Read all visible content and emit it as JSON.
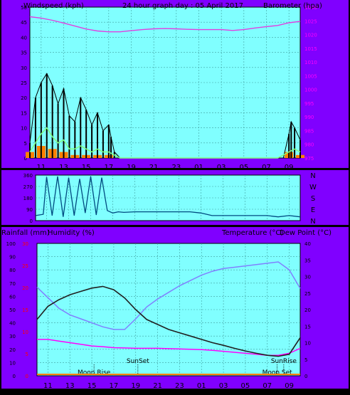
{
  "header": {
    "left_label": "Windspeed (kph)",
    "title": "24 hour graph day : 05 April 2017",
    "right_label": "Barometer (hpa)"
  },
  "labels": {
    "rainfall": "Rainfall (mm)",
    "humidity": "Humidity (%)",
    "temperature": "Temperature (°C)",
    "dew_point": "Dew Point (°C)"
  },
  "x_ticks": [
    "11",
    "13",
    "15",
    "17",
    "19",
    "21",
    "23",
    "01",
    "03",
    "05",
    "07",
    "09"
  ],
  "x_ticks_bottom": [
    "11",
    "13",
    "15",
    "17",
    "19",
    "21",
    "23",
    "01",
    "03",
    "05",
    "07",
    "09"
  ],
  "events": [
    {
      "label": "Moon Rise",
      "hour": "14.2"
    },
    {
      "label": "SunSet",
      "hour": "18.2"
    },
    {
      "label": "Moon Set",
      "hour": "30.9"
    },
    {
      "label": "SunRise",
      "hour": "31.5"
    }
  ],
  "colors": {
    "plot_bg": "#80ffff",
    "frame": "#8000ff",
    "wind_gust": "#000000",
    "wind_avg": "#80ff80",
    "rain": "#ff8000",
    "barometer": "#e040e0",
    "humidity": "#8080ff",
    "temperature": "#202020",
    "dewpoint": "#ff00ff",
    "direction": "#004a80"
  },
  "chart_data": [
    {
      "type": "line",
      "title": "24 hour graph day : 05 April 2017",
      "xlabel": "",
      "x_range_hours": [
        9,
        33
      ],
      "y_left": {
        "label": "Windspeed (kph)",
        "range": [
          0,
          50
        ],
        "ticks": [
          "0",
          "5",
          "10",
          "15",
          "20",
          "25",
          "30",
          "35",
          "40",
          "45",
          "50"
        ]
      },
      "y_right": {
        "label": "Barometer (hpa)",
        "range": [
          975,
          1030
        ],
        "ticks": [
          "975",
          "980",
          "985",
          "990",
          "995",
          "1000",
          "1005",
          "1010",
          "1015",
          "1020",
          "1025",
          "1030"
        ]
      },
      "series": [
        {
          "name": "Barometer (hpa)",
          "axis": "right",
          "x": [
            9,
            10,
            11,
            12,
            13,
            14,
            15,
            16,
            17,
            18,
            19,
            20,
            21,
            22,
            23,
            24,
            25,
            26,
            27,
            28,
            29,
            30,
            31,
            32,
            33
          ],
          "values": [
            1026.5,
            1026.0,
            1025.2,
            1024.2,
            1023.1,
            1022.0,
            1021.3,
            1021.0,
            1021.0,
            1021.4,
            1021.8,
            1022.1,
            1022.2,
            1022.1,
            1021.9,
            1021.8,
            1021.8,
            1021.8,
            1021.5,
            1021.8,
            1022.4,
            1022.9,
            1023.3,
            1024.3,
            1024.8
          ]
        },
        {
          "name": "Windspeed gust (kph)",
          "axis": "left",
          "x": [
            9,
            9.5,
            10,
            10.5,
            11,
            11.5,
            12,
            12.5,
            13,
            13.5,
            14,
            14.5,
            15,
            15.5,
            16,
            16.2,
            16.5,
            17,
            31,
            31.5,
            32,
            32.2,
            32.5,
            33
          ],
          "values": [
            5,
            20,
            25,
            28,
            24,
            18,
            23,
            14,
            12,
            20,
            16,
            11,
            15,
            9,
            11,
            7,
            2,
            0,
            0,
            0,
            8,
            12,
            10,
            6
          ]
        },
        {
          "name": "Windspeed avg (kph)",
          "axis": "left",
          "x": [
            9,
            9.5,
            10,
            10.5,
            11,
            11.5,
            12,
            12.5,
            13,
            13.5,
            14,
            14.5,
            15,
            15.5,
            16,
            16.5,
            17,
            31,
            32,
            32.5,
            33
          ],
          "values": [
            2,
            5,
            8,
            10,
            7,
            5,
            6,
            3,
            3,
            4,
            3,
            2,
            3,
            2,
            2,
            1,
            0,
            0,
            2,
            3,
            2
          ]
        },
        {
          "name": "Rainfall (mm)",
          "axis": "left",
          "x": [
            9,
            10,
            11,
            12,
            13,
            14,
            15,
            16,
            17,
            31,
            32,
            33
          ],
          "values": [
            2,
            4,
            3,
            2,
            1,
            1,
            1,
            1,
            0,
            0,
            2,
            1
          ]
        }
      ]
    },
    {
      "type": "scatter",
      "title": "",
      "x_range_hours": [
        9,
        33
      ],
      "y_ticks_left": [
        "360",
        "270",
        "180",
        "90",
        "0"
      ],
      "y_ticks_right": [
        "N",
        "W",
        "S",
        "E",
        "N"
      ],
      "series": [
        {
          "name": "Wind direction",
          "x": [
            9,
            9.7,
            10,
            10.5,
            11,
            11.5,
            12,
            12.5,
            13,
            13.5,
            14,
            14.5,
            15,
            15.5,
            16,
            16.5,
            17,
            18,
            19,
            20,
            21,
            22,
            23,
            24,
            25,
            26,
            27,
            28,
            29,
            30,
            31,
            32,
            33
          ],
          "values": [
            40,
            50,
            345,
            40,
            350,
            30,
            340,
            40,
            330,
            60,
            350,
            45,
            340,
            80,
            60,
            70,
            65,
            70,
            70,
            70,
            70,
            70,
            70,
            60,
            40,
            40,
            40,
            40,
            40,
            40,
            30,
            40,
            30
          ]
        }
      ]
    },
    {
      "type": "line",
      "title": "",
      "x_range_hours": [
        9,
        33
      ],
      "y_left": {
        "label": "Humidity (%)",
        "range": [
          0,
          100
        ],
        "ticks": [
          "0",
          "10",
          "20",
          "30",
          "40",
          "50",
          "60",
          "70",
          "80",
          "90",
          "100"
        ]
      },
      "y_left_rain": {
        "label": "Rainfall (mm)",
        "range": [
          0,
          30
        ],
        "ticks": [
          "0",
          "5",
          "10",
          "15",
          "20",
          "25",
          "30"
        ]
      },
      "y_right": {
        "label": "Temperature (°C)",
        "range": [
          0,
          40
        ],
        "ticks": [
          "0",
          "5",
          "10",
          "15",
          "20",
          "25",
          "30",
          "35",
          "40"
        ]
      },
      "series": [
        {
          "name": "Humidity (%)",
          "axis": "left",
          "x": [
            9,
            10,
            11,
            12,
            13,
            14,
            15,
            16,
            17,
            18,
            19,
            20,
            21,
            22,
            23,
            24,
            25,
            26,
            27,
            28,
            29,
            30,
            31,
            32,
            33
          ],
          "values": [
            67,
            59,
            51,
            46,
            43,
            40,
            37,
            35,
            35,
            43,
            52,
            58,
            63,
            68,
            72,
            76,
            79,
            81,
            82,
            83,
            84,
            85,
            86,
            80,
            66
          ]
        },
        {
          "name": "Temperature (°C)",
          "axis": "right",
          "x": [
            9,
            10,
            11,
            12,
            13,
            14,
            15,
            16,
            17,
            18,
            19,
            20,
            21,
            22,
            23,
            24,
            25,
            26,
            27,
            28,
            29,
            30,
            31,
            32,
            33
          ],
          "values": [
            17,
            21,
            23,
            24.5,
            25.5,
            26.5,
            27,
            26,
            23.5,
            20,
            17,
            15.5,
            14,
            13,
            12,
            11,
            10,
            9.2,
            8.3,
            7.5,
            6.8,
            6.2,
            5.9,
            6.5,
            11.5
          ]
        },
        {
          "name": "Dew Point (°C)",
          "axis": "right",
          "x": [
            9,
            10,
            11,
            12,
            13,
            14,
            15,
            16,
            17,
            18,
            19,
            20,
            21,
            22,
            23,
            24,
            25,
            26,
            27,
            28,
            29,
            30,
            31,
            32,
            33
          ],
          "values": [
            11,
            11,
            10.5,
            10,
            9.5,
            9,
            8.8,
            8.5,
            8.4,
            8.3,
            8.3,
            8.3,
            8.2,
            8.1,
            8,
            7.9,
            7.7,
            7.4,
            7.1,
            6.8,
            6.5,
            6.2,
            6.2,
            6.8,
            8.3
          ]
        }
      ]
    }
  ]
}
